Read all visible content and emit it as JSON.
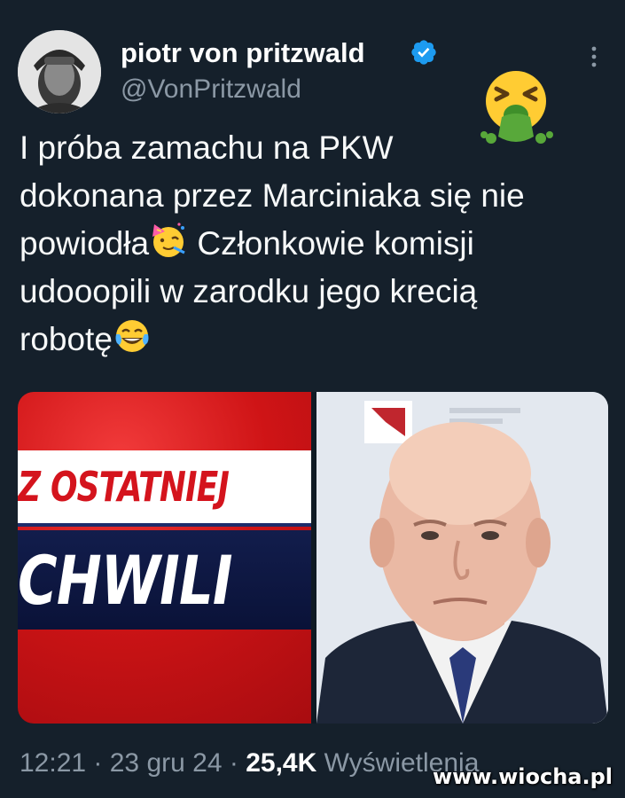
{
  "author": {
    "name": "piotr von pritzwald",
    "handle": "@VonPritzwald"
  },
  "tweet": {
    "lines": [
      "I próba zamachu na PKW",
      "dokonana przez Marciniaka się nie",
      "powiodła",
      " Członkowie komisji",
      "udooopili w zarodku jego krecią",
      "robotę"
    ]
  },
  "media": {
    "left_card": {
      "line1": "Z OSTATNIEJ",
      "line2": "CHWILI"
    }
  },
  "meta": {
    "time": "12:21",
    "separator": " · ",
    "date": "23 gru 24",
    "views_count": "25,4K",
    "views_label": "Wyświetlenia"
  },
  "watermark": "www.wiocha.pl",
  "icons": {
    "verified": "verified-badge-icon",
    "more": "more-options-icon",
    "vomit": "face-vomiting-emoji",
    "party": "partying-face-emoji",
    "laughing": "tears-of-joy-emoji"
  },
  "colors": {
    "background": "#15202b",
    "secondary_text": "#8b98a5",
    "verified_blue": "#1d9bf0"
  }
}
